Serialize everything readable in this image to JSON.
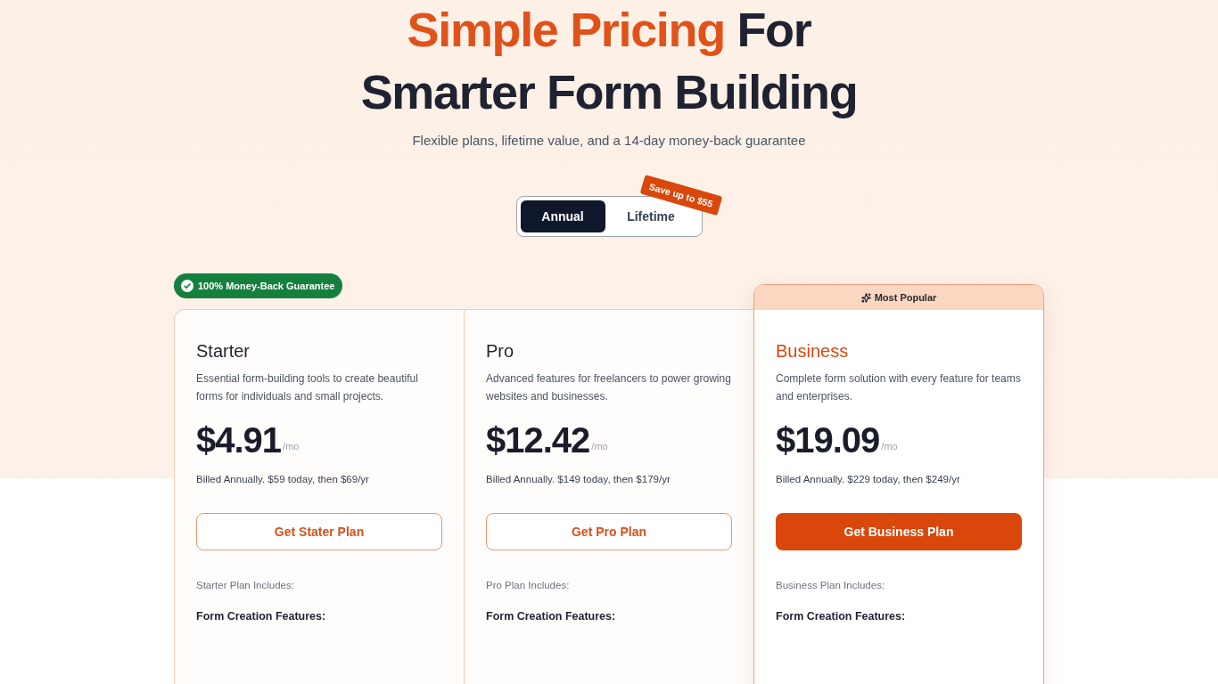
{
  "hero": {
    "title_lines": [
      [
        {
          "text": "Simple Pricing",
          "highlight": true
        },
        {
          "text": "For",
          "highlight": false
        }
      ],
      [
        {
          "text": "Smarter Form Building",
          "highlight": false
        }
      ]
    ],
    "subtitle": "Flexible plans, lifetime value, and a 14-day money-back guarantee"
  },
  "billing_toggle": {
    "options": [
      {
        "label": "Annual",
        "selected": true
      },
      {
        "label": "Lifetime",
        "selected": false
      }
    ],
    "badge": "Save up to $55"
  },
  "guarantee_badge": "100% Money-Back Guarantee",
  "plans": [
    {
      "name": "Starter",
      "featured": false,
      "description": "Essential form-building tools to create beautiful forms for individuals and small projects.",
      "price": "$4.91",
      "period": "/mo",
      "billing_note": "Billed Annually. $59 today, then $69/yr",
      "button": "Get Stater Plan",
      "includes_label": "Starter Plan Includes:",
      "section_heading": "Form Creation Features:"
    },
    {
      "name": "Pro",
      "featured": false,
      "description": "Advanced features for freelancers to power growing websites and businesses.",
      "price": "$12.42",
      "period": "/mo",
      "billing_note": "Billed Annually. $149 today, then $179/yr",
      "button": "Get Pro Plan",
      "includes_label": "Pro Plan Includes:",
      "section_heading": "Form Creation Features:"
    },
    {
      "name": "Business",
      "featured": true,
      "featured_label": "Most Popular",
      "description": "Complete form solution with every feature for teams and enterprises.",
      "price": "$19.09",
      "period": "/mo",
      "billing_note": "Billed Annually. $229 today, then $249/yr",
      "button": "Get Business Plan",
      "includes_label": "Business Plan Includes:",
      "section_heading": "Form Creation Features:"
    }
  ]
}
